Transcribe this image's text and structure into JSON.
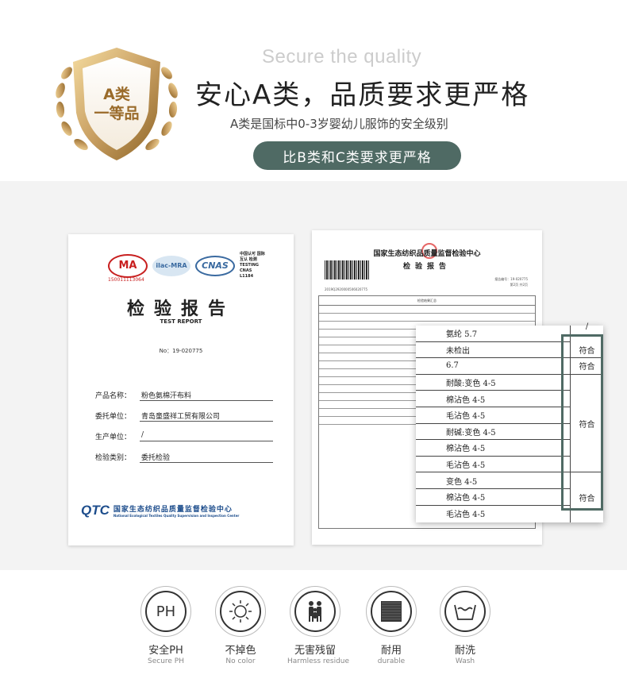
{
  "hero": {
    "badge_line1": "A类",
    "badge_line2": "一等品",
    "sub_en": "Secure the quality",
    "title": "安心A类，品质要求更严格",
    "desc": "A类是国标中0-3岁婴幼儿服饰的安全级别",
    "pill": "比B类和C类要求更严格"
  },
  "report": {
    "ma": "MA",
    "ma_code": "150011113064",
    "ilac": "ilac-MRA",
    "cnas": "CNAS",
    "cnas_info": "中国认可 国际互认 检测 TESTING CNAS L1184",
    "title": "检验报告",
    "title_en": "TEST REPORT",
    "no": "No：19-020775",
    "fields": [
      {
        "k": "产品名称：",
        "v": "粉色氨棉汗布料"
      },
      {
        "k": "委托单位：",
        "v": "青岛童盛祥工贸有限公司"
      },
      {
        "k": "生产单位：",
        "v": "/"
      },
      {
        "k": "检验类别：",
        "v": "委托检验"
      }
    ],
    "qtc_logo": "QTC",
    "qtc_cn": "国家生态纺织品质量监督检验中心",
    "qtc_en": "National Ecological Textiles Quality Supervision and Inspection Center"
  },
  "report2": {
    "title": "国家生态纺织品质量监督检验中心",
    "subtitle": "检验报告",
    "number": "2019Q2920000506020775",
    "report_no": "报告编号：19-020775",
    "page": "第2页 共2页",
    "summary_header": "检验结果汇总"
  },
  "results": {
    "rows": [
      "氨纶 5.7",
      "未检出",
      "6.7",
      "耐酸:变色 4-5",
      "棉沾色 4-5",
      "毛沾色 4-5",
      "耐碱:变色 4-5",
      "棉沾色 4-5",
      "毛沾色 4-5",
      "变色 4-5",
      "棉沾色 4-5",
      "毛沾色 4-5"
    ],
    "slash": "/",
    "pass1": "符合",
    "pass2": "符合",
    "pass3": "符合",
    "pass4": "符合"
  },
  "icons": [
    {
      "icon": "ph-icon",
      "glyph": "PH",
      "cn": "安全PH",
      "en": "Secure PH"
    },
    {
      "icon": "sun-icon",
      "cn": "不掉色",
      "en": "No color"
    },
    {
      "icon": "family-icon",
      "cn": "无害残留",
      "en": "Harmless residue"
    },
    {
      "icon": "fabric-icon",
      "cn": "耐用",
      "en": "durable"
    },
    {
      "icon": "wash-icon",
      "cn": "耐洗",
      "en": "Wash"
    }
  ],
  "colors": {
    "accent": "#4f6a64",
    "gold": "#c9a063"
  }
}
